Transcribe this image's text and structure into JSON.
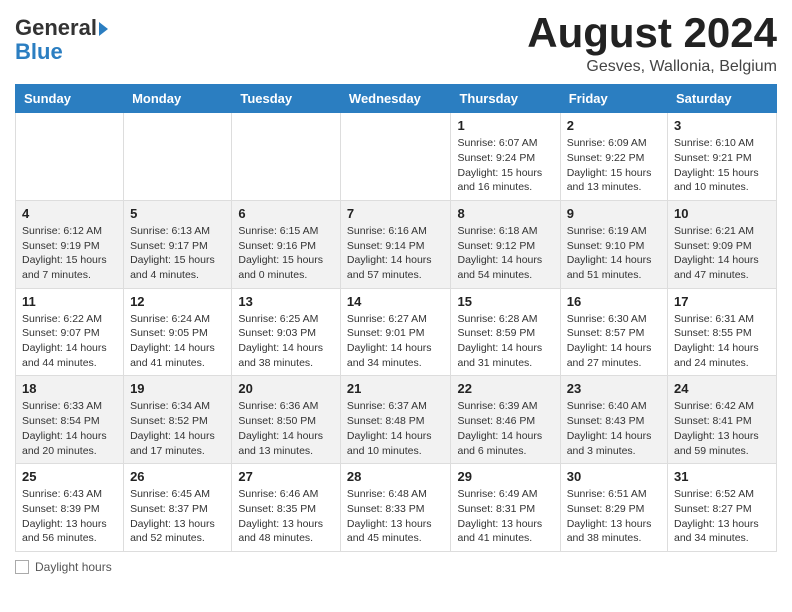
{
  "header": {
    "logo_general": "General",
    "logo_blue": "Blue",
    "month_title": "August 2024",
    "subtitle": "Gesves, Wallonia, Belgium"
  },
  "days_of_week": [
    "Sunday",
    "Monday",
    "Tuesday",
    "Wednesday",
    "Thursday",
    "Friday",
    "Saturday"
  ],
  "weeks": [
    [
      {
        "day": "",
        "info": ""
      },
      {
        "day": "",
        "info": ""
      },
      {
        "day": "",
        "info": ""
      },
      {
        "day": "",
        "info": ""
      },
      {
        "day": "1",
        "info": "Sunrise: 6:07 AM\nSunset: 9:24 PM\nDaylight: 15 hours and 16 minutes."
      },
      {
        "day": "2",
        "info": "Sunrise: 6:09 AM\nSunset: 9:22 PM\nDaylight: 15 hours and 13 minutes."
      },
      {
        "day": "3",
        "info": "Sunrise: 6:10 AM\nSunset: 9:21 PM\nDaylight: 15 hours and 10 minutes."
      }
    ],
    [
      {
        "day": "4",
        "info": "Sunrise: 6:12 AM\nSunset: 9:19 PM\nDaylight: 15 hours and 7 minutes."
      },
      {
        "day": "5",
        "info": "Sunrise: 6:13 AM\nSunset: 9:17 PM\nDaylight: 15 hours and 4 minutes."
      },
      {
        "day": "6",
        "info": "Sunrise: 6:15 AM\nSunset: 9:16 PM\nDaylight: 15 hours and 0 minutes."
      },
      {
        "day": "7",
        "info": "Sunrise: 6:16 AM\nSunset: 9:14 PM\nDaylight: 14 hours and 57 minutes."
      },
      {
        "day": "8",
        "info": "Sunrise: 6:18 AM\nSunset: 9:12 PM\nDaylight: 14 hours and 54 minutes."
      },
      {
        "day": "9",
        "info": "Sunrise: 6:19 AM\nSunset: 9:10 PM\nDaylight: 14 hours and 51 minutes."
      },
      {
        "day": "10",
        "info": "Sunrise: 6:21 AM\nSunset: 9:09 PM\nDaylight: 14 hours and 47 minutes."
      }
    ],
    [
      {
        "day": "11",
        "info": "Sunrise: 6:22 AM\nSunset: 9:07 PM\nDaylight: 14 hours and 44 minutes."
      },
      {
        "day": "12",
        "info": "Sunrise: 6:24 AM\nSunset: 9:05 PM\nDaylight: 14 hours and 41 minutes."
      },
      {
        "day": "13",
        "info": "Sunrise: 6:25 AM\nSunset: 9:03 PM\nDaylight: 14 hours and 38 minutes."
      },
      {
        "day": "14",
        "info": "Sunrise: 6:27 AM\nSunset: 9:01 PM\nDaylight: 14 hours and 34 minutes."
      },
      {
        "day": "15",
        "info": "Sunrise: 6:28 AM\nSunset: 8:59 PM\nDaylight: 14 hours and 31 minutes."
      },
      {
        "day": "16",
        "info": "Sunrise: 6:30 AM\nSunset: 8:57 PM\nDaylight: 14 hours and 27 minutes."
      },
      {
        "day": "17",
        "info": "Sunrise: 6:31 AM\nSunset: 8:55 PM\nDaylight: 14 hours and 24 minutes."
      }
    ],
    [
      {
        "day": "18",
        "info": "Sunrise: 6:33 AM\nSunset: 8:54 PM\nDaylight: 14 hours and 20 minutes."
      },
      {
        "day": "19",
        "info": "Sunrise: 6:34 AM\nSunset: 8:52 PM\nDaylight: 14 hours and 17 minutes."
      },
      {
        "day": "20",
        "info": "Sunrise: 6:36 AM\nSunset: 8:50 PM\nDaylight: 14 hours and 13 minutes."
      },
      {
        "day": "21",
        "info": "Sunrise: 6:37 AM\nSunset: 8:48 PM\nDaylight: 14 hours and 10 minutes."
      },
      {
        "day": "22",
        "info": "Sunrise: 6:39 AM\nSunset: 8:46 PM\nDaylight: 14 hours and 6 minutes."
      },
      {
        "day": "23",
        "info": "Sunrise: 6:40 AM\nSunset: 8:43 PM\nDaylight: 14 hours and 3 minutes."
      },
      {
        "day": "24",
        "info": "Sunrise: 6:42 AM\nSunset: 8:41 PM\nDaylight: 13 hours and 59 minutes."
      }
    ],
    [
      {
        "day": "25",
        "info": "Sunrise: 6:43 AM\nSunset: 8:39 PM\nDaylight: 13 hours and 56 minutes."
      },
      {
        "day": "26",
        "info": "Sunrise: 6:45 AM\nSunset: 8:37 PM\nDaylight: 13 hours and 52 minutes."
      },
      {
        "day": "27",
        "info": "Sunrise: 6:46 AM\nSunset: 8:35 PM\nDaylight: 13 hours and 48 minutes."
      },
      {
        "day": "28",
        "info": "Sunrise: 6:48 AM\nSunset: 8:33 PM\nDaylight: 13 hours and 45 minutes."
      },
      {
        "day": "29",
        "info": "Sunrise: 6:49 AM\nSunset: 8:31 PM\nDaylight: 13 hours and 41 minutes."
      },
      {
        "day": "30",
        "info": "Sunrise: 6:51 AM\nSunset: 8:29 PM\nDaylight: 13 hours and 38 minutes."
      },
      {
        "day": "31",
        "info": "Sunrise: 6:52 AM\nSunset: 8:27 PM\nDaylight: 13 hours and 34 minutes."
      }
    ]
  ],
  "footer": {
    "daylight_label": "Daylight hours"
  }
}
